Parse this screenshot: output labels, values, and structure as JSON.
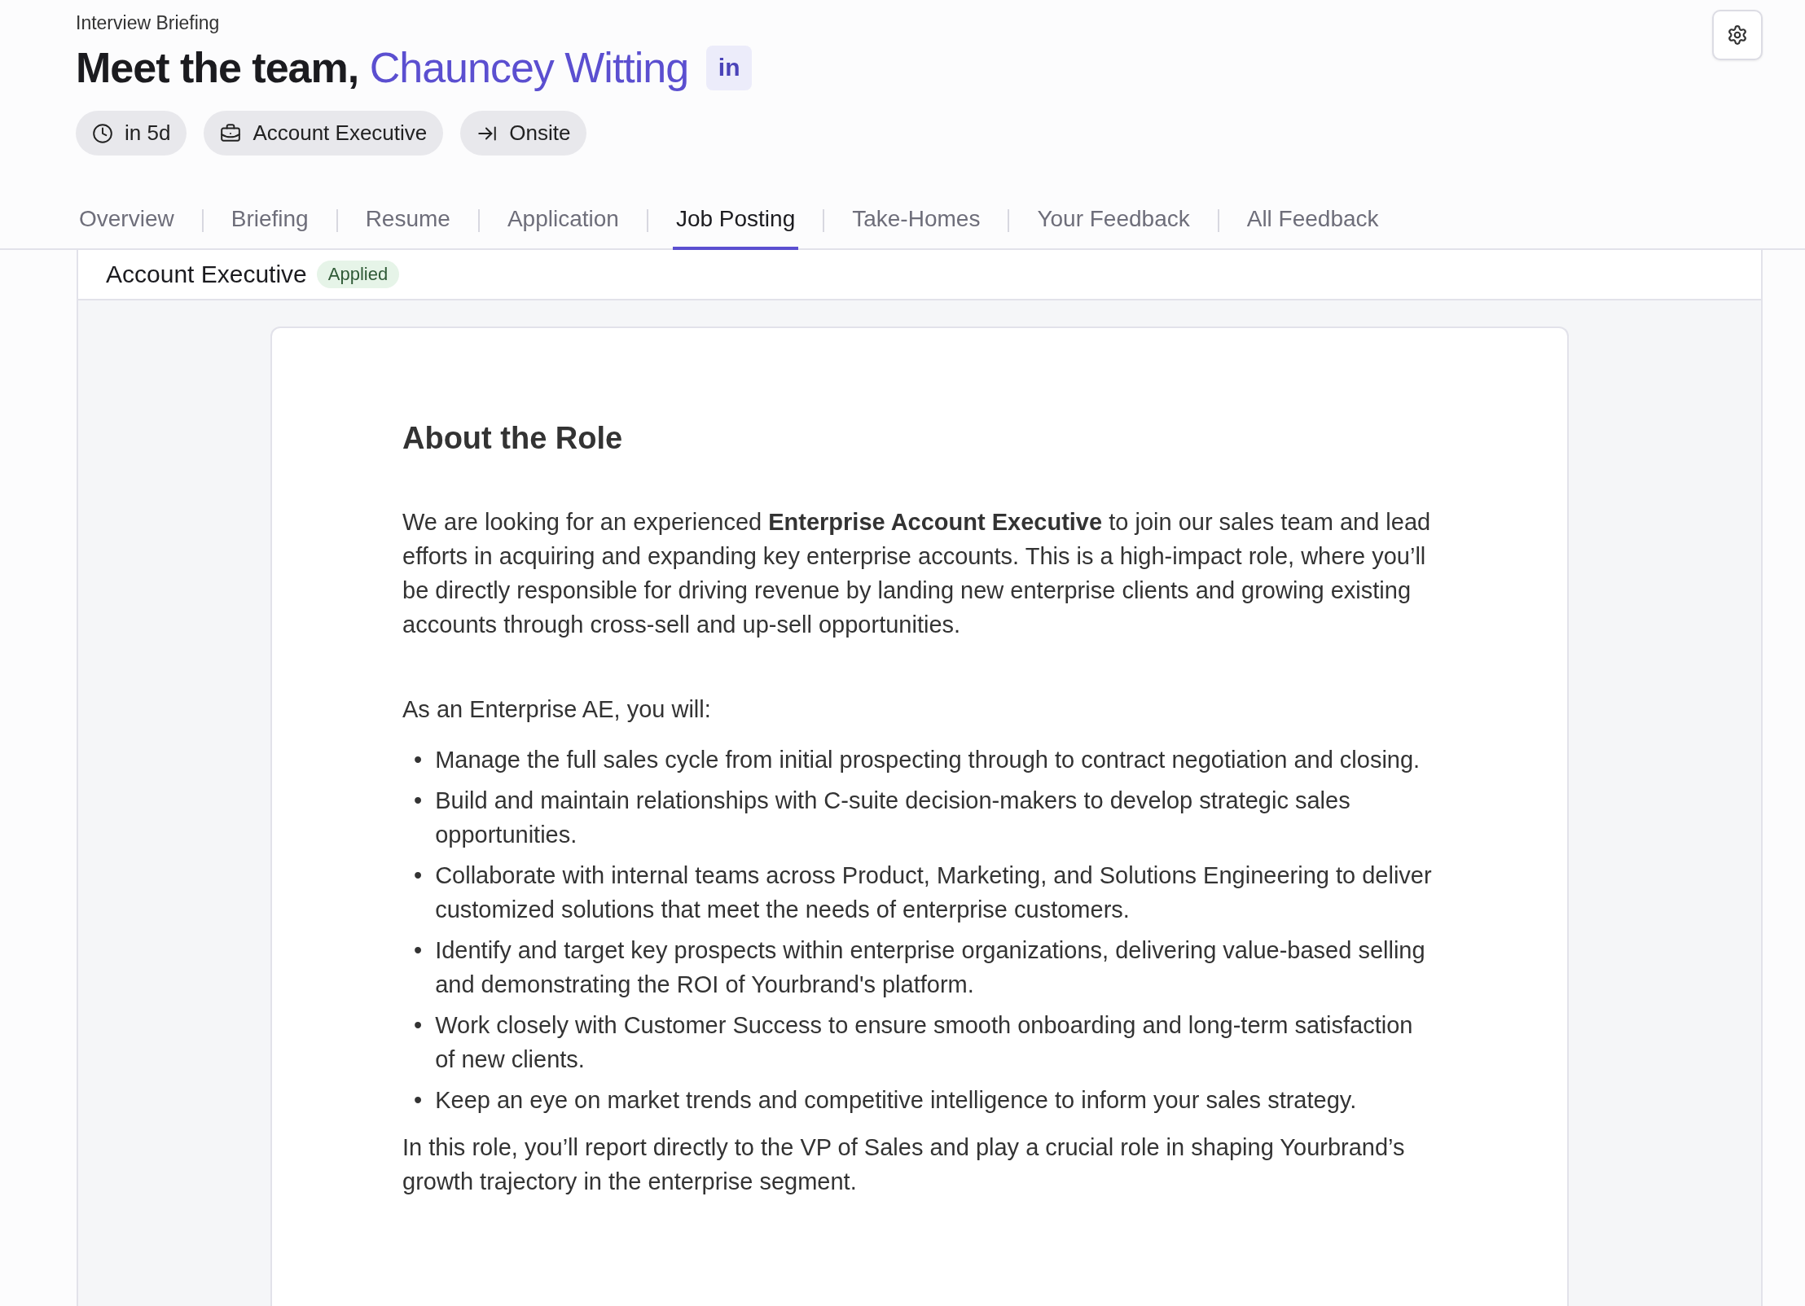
{
  "header": {
    "eyebrow": "Interview Briefing",
    "title_prefix": "Meet the team,",
    "candidate_name": "Chauncey Witting",
    "profile_badge": "in"
  },
  "pills": [
    {
      "kind": "time",
      "label": "in 5d"
    },
    {
      "kind": "role",
      "label": "Account Executive"
    },
    {
      "kind": "stage",
      "label": "Onsite"
    }
  ],
  "tabs": [
    {
      "label": "Overview",
      "selected": false
    },
    {
      "label": "Briefing",
      "selected": false
    },
    {
      "label": "Resume",
      "selected": false
    },
    {
      "label": "Application",
      "selected": false
    },
    {
      "label": "Job Posting",
      "selected": true
    },
    {
      "label": "Take-Homes",
      "selected": false
    },
    {
      "label": "Your Feedback",
      "selected": false
    },
    {
      "label": "All Feedback",
      "selected": false
    }
  ],
  "job": {
    "title": "Account Executive",
    "status": "Applied"
  },
  "posting": {
    "heading": "About the Role",
    "intro": "We are looking for an experienced **Enterprise Account Executive** to join our sales team and lead efforts in acquiring and expanding key enterprise accounts. This is a high-impact role, where you’ll be directly responsible for driving revenue by landing new enterprise clients and growing existing accounts through cross-sell and up-sell opportunities.",
    "lead": "As an Enterprise AE, you will:",
    "bullets": [
      {
        "marker": "•",
        "text": "Manage the full sales cycle from initial prospecting through to contract negotiation and closing."
      },
      {
        "marker": "•",
        "text": "Build and maintain relationships with C-suite decision-makers to develop strategic sales opportunities."
      },
      {
        "marker": "•",
        "text": "Collaborate with internal teams across Product, Marketing, and Solutions Engineering to deliver customized solutions that meet the needs of enterprise customers."
      },
      {
        "marker": "•",
        "text": "Identify and target key prospects within enterprise organizations, delivering value-based selling and demonstrating the ROI of Yourbrand's platform."
      },
      {
        "marker": "•",
        "text": "Work closely with Customer Success to ensure smooth onboarding and long-term satisfaction of new clients."
      },
      {
        "marker": "•",
        "text": "Keep an eye on market trends and competitive intelligence to inform your sales strategy."
      }
    ],
    "closing": "In this role, you’ll report directly to the VP of Sales and play a crucial role in shaping Yourbrand’s growth trajectory in the enterprise segment."
  }
}
